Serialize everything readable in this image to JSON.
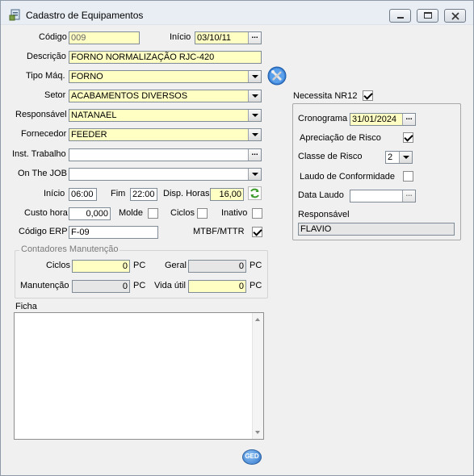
{
  "window": {
    "title": "Cadastro de Equipamentos",
    "minimize_icon": "minimize-icon",
    "maximize_icon": "maximize-icon",
    "close_icon": "close-icon"
  },
  "form": {
    "codigo": {
      "label": "Código",
      "value": "009"
    },
    "inicio_date": {
      "label": "Início",
      "value": "03/10/11"
    },
    "descricao": {
      "label": "Descrição",
      "value": "FORNO NORMALIZAÇÃO RJC-420"
    },
    "tipo_maq": {
      "label": "Tipo Máq.",
      "value": "FORNO"
    },
    "setor": {
      "label": "Setor",
      "value": "ACABAMENTOS DIVERSOS"
    },
    "responsavel": {
      "label": "Responsável",
      "value": "NATANAEL"
    },
    "fornecedor": {
      "label": "Fornecedor",
      "value": "FEEDER"
    },
    "inst_trabalho": {
      "label": "Inst. Trabalho",
      "value": ""
    },
    "on_the_job": {
      "label": "On The JOB",
      "value": ""
    },
    "inicio_time": {
      "label": "Início",
      "value": "06:00"
    },
    "fim": {
      "label": "Fim",
      "value": "22:00"
    },
    "disp_horas": {
      "label": "Disp. Horas",
      "value": "16,00"
    },
    "custo_hora": {
      "label": "Custo hora",
      "value": "0,000"
    },
    "molde": {
      "label": "Molde",
      "checked": false
    },
    "ciclos_chk": {
      "label": "Ciclos",
      "checked": false
    },
    "inativo": {
      "label": "Inativo",
      "checked": false
    },
    "codigo_erp": {
      "label": "Código ERP",
      "value": "F-09"
    },
    "mtbf_mttr": {
      "label": "MTBF/MTTR",
      "checked": true
    }
  },
  "contadores": {
    "title": "Contadores Manutenção",
    "ciclos": {
      "label": "Ciclos",
      "value": "0",
      "unit": "PC"
    },
    "geral": {
      "label": "Geral",
      "value": "0",
      "unit": "PC"
    },
    "manutencao": {
      "label": "Manutenção",
      "value": "0",
      "unit": "PC"
    },
    "vida_util": {
      "label": "Vida útil",
      "value": "0",
      "unit": "PC"
    }
  },
  "ficha": {
    "label": "Ficha",
    "value": ""
  },
  "nr12": {
    "label": "Necessita NR12",
    "checked": true,
    "cronograma": {
      "label": "Cronograma",
      "value": "31/01/2024"
    },
    "apreciacao": {
      "label": "Apreciação de Risco",
      "checked": true
    },
    "classe_risco": {
      "label": "Classe de Risco",
      "value": "2"
    },
    "laudo_conformidade": {
      "label": "Laudo de Conformidade",
      "checked": false
    },
    "data_laudo": {
      "label": "Data Laudo",
      "value": ""
    },
    "responsavel": {
      "label": "Responsável",
      "value": "FLAVIO"
    }
  },
  "buttons": {
    "dots": "...",
    "ged": "GED"
  }
}
